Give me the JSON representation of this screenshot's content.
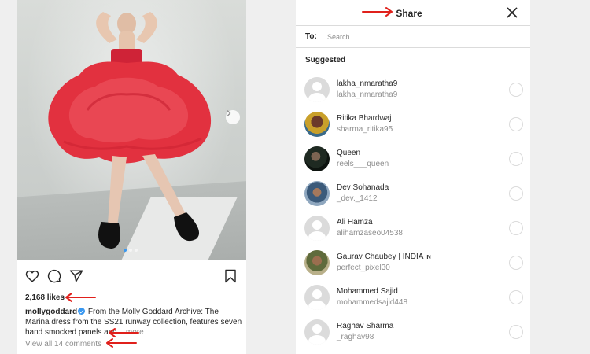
{
  "post": {
    "likes": "2,168 likes",
    "caption_user": "mollygoddard",
    "caption_text": " From the Molly Goddard Archive: The Marina dress from the SS21 runway collection, features seven hand smocked panels and...",
    "more_label": " more",
    "view_comments": "View all 14 comments",
    "carousel": {
      "slides": 3,
      "active_slide": 1
    },
    "icons": [
      "heart-icon",
      "comment-icon",
      "share-icon",
      "bookmark-icon",
      "chevron-right-icon"
    ]
  },
  "share": {
    "title": "Share",
    "to_label": "To:",
    "search_placeholder": "Search...",
    "suggested_label": "Suggested",
    "users": [
      {
        "name": "lakha_nmaratha9",
        "handle": "lakha_nmaratha9",
        "avatar": "default"
      },
      {
        "name": "Ritika Bhardwaj",
        "handle": "sharma_ritika95",
        "avatar": "photo"
      },
      {
        "name": "Queen",
        "handle": "reels___queen",
        "avatar": "photo"
      },
      {
        "name": "Dev Sohanada",
        "handle": "_dev._1412",
        "avatar": "photo"
      },
      {
        "name": "Ali Hamza",
        "handle": "alihamzaseo04538",
        "avatar": "default"
      },
      {
        "name": "Gaurav Chaubey | INDIA",
        "name_suffix": "IN",
        "handle": "perfect_pixel30",
        "avatar": "photo"
      },
      {
        "name": "Mohammed Sajid",
        "handle": "mohammedsajid448",
        "avatar": "default"
      },
      {
        "name": "Raghav Sharma",
        "handle": "_raghav98",
        "avatar": "default"
      }
    ]
  },
  "colors": {
    "annotation_arrow": "#e0201b",
    "link_blue": "#3897f0",
    "dress_red": "#e2313f"
  }
}
